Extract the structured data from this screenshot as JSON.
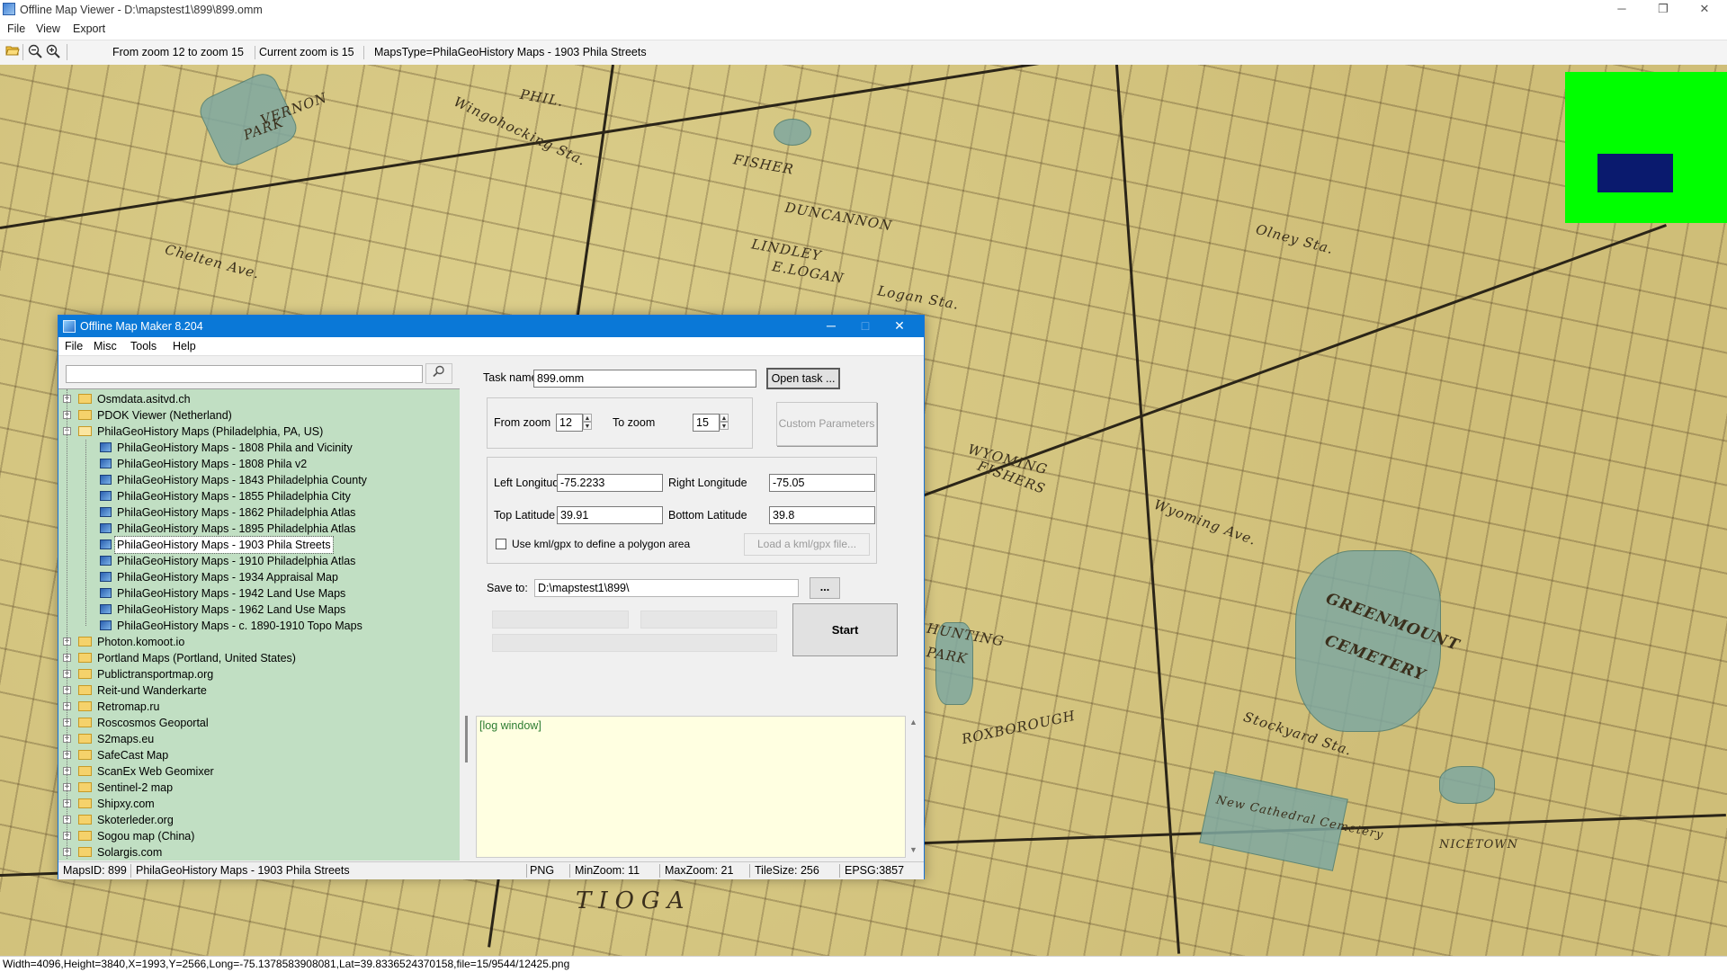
{
  "window": {
    "title": "Offline Map Viewer - D:\\mapstest1\\899\\899.omm",
    "minimize": "─",
    "restore": "❐",
    "close": "✕"
  },
  "menu": {
    "file": "File",
    "view": "View",
    "export": "Export"
  },
  "toolbar": {
    "open_icon": "folder-open-icon",
    "zoom_out_icon": "zoom-out-icon",
    "zoom_in_icon": "zoom-in-icon",
    "zoom_range": "From zoom 12 to zoom 15",
    "current_zoom": "Current zoom is 15",
    "maps_type": "MapsType=PhilaGeoHistory Maps - 1903 Phila Streets"
  },
  "map_labels": [
    "VERNON",
    "PARK",
    "PHIL.",
    "FISHER",
    "DUNCANNON",
    "LINDLEY",
    "E.LOGAN",
    "Logan Sta.",
    "Olney Sta.",
    "FISHERS",
    "Wyoming Ave.",
    "WYOMING",
    "HUNTING",
    "PARK",
    "GREENMOUNT",
    "CEMETERY",
    "New Cathedral Cemetery",
    "NICETOWN",
    "TIOGA",
    "Stockyard Sta.",
    "Chelten Ave.",
    "Wingohocking Sta.",
    "ROXBOROUGH"
  ],
  "overview": {
    "bg": "#00ff00",
    "viewport": "#0a1a6e"
  },
  "statusbar": {
    "text": "Width=4096,Height=3840,X=1993,Y=2566,Long=-75.1378583908081,Lat=39.8336524370158,file=15/9544/12425.png"
  },
  "dialog": {
    "title": "Offline Map Maker 8.204",
    "menu": {
      "file": "File",
      "misc": "Misc",
      "tools": "Tools",
      "help": "Help"
    },
    "search": {
      "value": "",
      "icon": "search-icon"
    },
    "tree": [
      {
        "label": "Osmdata.asitvd.ch",
        "kind": "folder",
        "expanded": false
      },
      {
        "label": "PDOK Viewer (Netherland)",
        "kind": "folder",
        "expanded": false
      },
      {
        "label": "PhilaGeoHistory Maps (Philadelphia, PA, US)",
        "kind": "folder",
        "expanded": true
      },
      {
        "label": "PhilaGeoHistory Maps - 1808 Phila and Vicinity",
        "kind": "map"
      },
      {
        "label": "PhilaGeoHistory Maps - 1808 Phila v2",
        "kind": "map"
      },
      {
        "label": "PhilaGeoHistory Maps - 1843 Philadelphia County",
        "kind": "map"
      },
      {
        "label": "PhilaGeoHistory Maps - 1855 Philadelphia City",
        "kind": "map"
      },
      {
        "label": "PhilaGeoHistory Maps - 1862 Philadelphia Atlas",
        "kind": "map"
      },
      {
        "label": "PhilaGeoHistory Maps - 1895 Philadelphia Atlas",
        "kind": "map"
      },
      {
        "label": "PhilaGeoHistory Maps - 1903 Phila Streets",
        "kind": "map",
        "selected": true
      },
      {
        "label": "PhilaGeoHistory Maps - 1910 Philadelphia Atlas",
        "kind": "map"
      },
      {
        "label": "PhilaGeoHistory Maps - 1934 Appraisal Map",
        "kind": "map"
      },
      {
        "label": "PhilaGeoHistory Maps - 1942 Land Use Maps",
        "kind": "map"
      },
      {
        "label": "PhilaGeoHistory Maps - 1962 Land Use Maps",
        "kind": "map"
      },
      {
        "label": "PhilaGeoHistory Maps - c. 1890-1910 Topo Maps",
        "kind": "map"
      },
      {
        "label": "Photon.komoot.io",
        "kind": "folder",
        "expanded": false
      },
      {
        "label": "Portland Maps (Portland, United States)",
        "kind": "folder",
        "expanded": false
      },
      {
        "label": "Publictransportmap.org",
        "kind": "folder",
        "expanded": false
      },
      {
        "label": "Reit-und Wanderkarte",
        "kind": "folder",
        "expanded": false
      },
      {
        "label": "Retromap.ru",
        "kind": "folder",
        "expanded": false
      },
      {
        "label": "Roscosmos Geoportal",
        "kind": "folder",
        "expanded": false
      },
      {
        "label": "S2maps.eu",
        "kind": "folder",
        "expanded": false
      },
      {
        "label": "SafeCast Map",
        "kind": "folder",
        "expanded": false
      },
      {
        "label": "ScanEx Web Geomixer",
        "kind": "folder",
        "expanded": false
      },
      {
        "label": "Sentinel-2 map",
        "kind": "folder",
        "expanded": false
      },
      {
        "label": "Shipxy.com",
        "kind": "folder",
        "expanded": false
      },
      {
        "label": "Skoterleder.org",
        "kind": "folder",
        "expanded": false
      },
      {
        "label": "Sogou map (China)",
        "kind": "folder",
        "expanded": false
      },
      {
        "label": "Solargis.com",
        "kind": "folder",
        "expanded": false
      }
    ],
    "form": {
      "task_name_label": "Task name",
      "task_name_value": "899.omm",
      "open_task": "Open task ...",
      "from_zoom_label": "From zoom",
      "from_zoom_value": "12",
      "to_zoom_label": "To zoom",
      "to_zoom_value": "15",
      "custom_params": "Custom Parameters",
      "left_lon_label": "Left Longitude",
      "left_lon_value": "-75.2233",
      "right_lon_label": "Right Longitude",
      "right_lon_value": "-75.05",
      "top_lat_label": "Top Latitude",
      "top_lat_value": "39.91",
      "bottom_lat_label": "Bottom Latitude",
      "bottom_lat_value": "39.8",
      "kml_check_label": "Use kml/gpx to define a polygon area",
      "kml_checked": false,
      "load_kml": "Load a kml/gpx file...",
      "save_to_label": "Save to:",
      "save_to_value": "D:\\mapstest1\\899\\",
      "browse": "...",
      "start": "Start"
    },
    "log": "[log window]",
    "status": {
      "maps_id": "MapsID: 899",
      "maps_name": "PhilaGeoHistory Maps - 1903 Phila Streets",
      "format": "PNG",
      "min_zoom": "MinZoom: 11",
      "max_zoom": "MaxZoom: 21",
      "tile_size": "TileSize: 256",
      "epsg": "EPSG:3857"
    }
  }
}
